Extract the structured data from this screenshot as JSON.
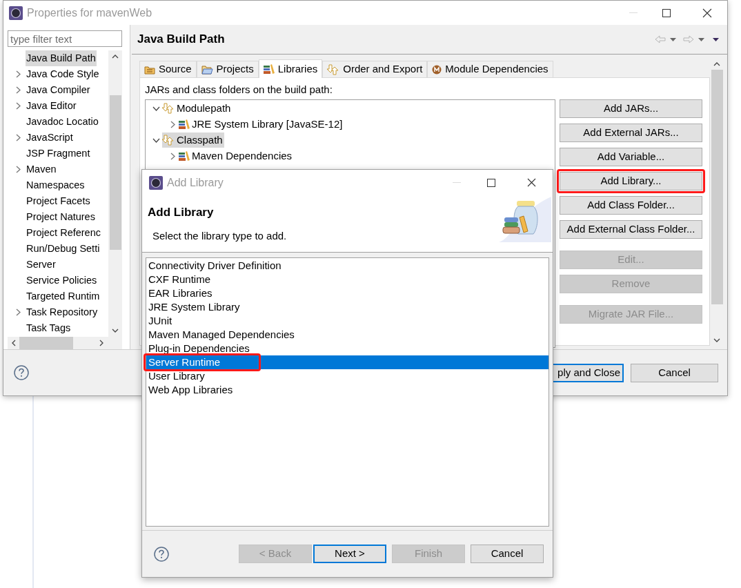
{
  "properties_window": {
    "title": "Properties for mavenWeb",
    "filter": {
      "placeholder": "type filter text"
    },
    "sidebar": {
      "items": [
        {
          "label": "Java Build Path",
          "expandable": false,
          "selected": true
        },
        {
          "label": "Java Code Style",
          "expandable": true,
          "selected": false
        },
        {
          "label": "Java Compiler",
          "expandable": true,
          "selected": false
        },
        {
          "label": "Java Editor",
          "expandable": true,
          "selected": false
        },
        {
          "label": "Javadoc Locatio",
          "expandable": false,
          "selected": false
        },
        {
          "label": "JavaScript",
          "expandable": true,
          "selected": false
        },
        {
          "label": "JSP Fragment",
          "expandable": false,
          "selected": false
        },
        {
          "label": "Maven",
          "expandable": true,
          "selected": false
        },
        {
          "label": "Namespaces",
          "expandable": false,
          "selected": false
        },
        {
          "label": "Project Facets",
          "expandable": false,
          "selected": false
        },
        {
          "label": "Project Natures",
          "expandable": false,
          "selected": false
        },
        {
          "label": "Project Referenc",
          "expandable": false,
          "selected": false
        },
        {
          "label": "Run/Debug Setti",
          "expandable": false,
          "selected": false
        },
        {
          "label": "Server",
          "expandable": false,
          "selected": false
        },
        {
          "label": "Service Policies",
          "expandable": false,
          "selected": false
        },
        {
          "label": "Targeted Runtim",
          "expandable": false,
          "selected": false
        },
        {
          "label": "Task Repository",
          "expandable": true,
          "selected": false
        },
        {
          "label": "Task Tags",
          "expandable": false,
          "selected": false
        }
      ]
    },
    "page_title": "Java Build Path",
    "tabs": [
      {
        "label": "Source",
        "kind": "source",
        "selected": false
      },
      {
        "label": "Projects",
        "kind": "projects",
        "selected": false
      },
      {
        "label": "Libraries",
        "kind": "libraries",
        "selected": true
      },
      {
        "label": "Order and Export",
        "kind": "order",
        "selected": false
      },
      {
        "label": "Module Dependencies",
        "kind": "module",
        "selected": false
      }
    ],
    "build_path_label": "JARs and class folders on the build path:",
    "tree": [
      {
        "label": "Modulepath",
        "expanded": true,
        "selected": false,
        "children": [
          {
            "label": "JRE System Library [JavaSE-12]",
            "expanded": false,
            "selected": false
          }
        ]
      },
      {
        "label": "Classpath",
        "expanded": true,
        "selected": true,
        "children": [
          {
            "label": "Maven Dependencies",
            "expanded": false,
            "selected": false
          }
        ]
      }
    ],
    "button_groups": [
      [
        {
          "label": "Add JARs...",
          "disabled": false,
          "highlighted": false
        },
        {
          "label": "Add External JARs...",
          "disabled": false,
          "highlighted": false
        },
        {
          "label": "Add Variable...",
          "disabled": false,
          "highlighted": false
        },
        {
          "label": "Add Library...",
          "disabled": false,
          "highlighted": true
        },
        {
          "label": "Add Class Folder...",
          "disabled": false,
          "highlighted": false
        },
        {
          "label": "Add External Class Folder...",
          "disabled": false,
          "highlighted": false
        }
      ],
      [
        {
          "label": "Edit...",
          "disabled": true,
          "highlighted": false
        },
        {
          "label": "Remove",
          "disabled": true,
          "highlighted": false
        }
      ],
      [
        {
          "label": "Migrate JAR File...",
          "disabled": true,
          "highlighted": false
        }
      ]
    ],
    "footer_buttons": [
      {
        "label": "ply and Close",
        "default": true
      },
      {
        "label": "Cancel",
        "default": false
      }
    ]
  },
  "add_library_dialog": {
    "title": "Add Library",
    "heading": "Add Library",
    "description": "Select the library type to add.",
    "library_types": [
      {
        "label": "Connectivity Driver Definition",
        "selected": false,
        "highlighted": false
      },
      {
        "label": "CXF Runtime",
        "selected": false,
        "highlighted": false
      },
      {
        "label": "EAR Libraries",
        "selected": false,
        "highlighted": false
      },
      {
        "label": "JRE System Library",
        "selected": false,
        "highlighted": false
      },
      {
        "label": "JUnit",
        "selected": false,
        "highlighted": false
      },
      {
        "label": "Maven Managed Dependencies",
        "selected": false,
        "highlighted": false
      },
      {
        "label": "Plug-in Dependencies",
        "selected": false,
        "highlighted": false
      },
      {
        "label": "Server Runtime",
        "selected": true,
        "highlighted": true
      },
      {
        "label": "User Library",
        "selected": false,
        "highlighted": false
      },
      {
        "label": "Web App Libraries",
        "selected": false,
        "highlighted": false
      }
    ],
    "buttons": [
      {
        "label": "< Back",
        "disabled": true,
        "default": false
      },
      {
        "label": "Next >",
        "disabled": false,
        "default": true
      },
      {
        "label": "Finish",
        "disabled": true,
        "default": false
      },
      {
        "label": "Cancel",
        "disabled": false,
        "default": false
      }
    ]
  }
}
